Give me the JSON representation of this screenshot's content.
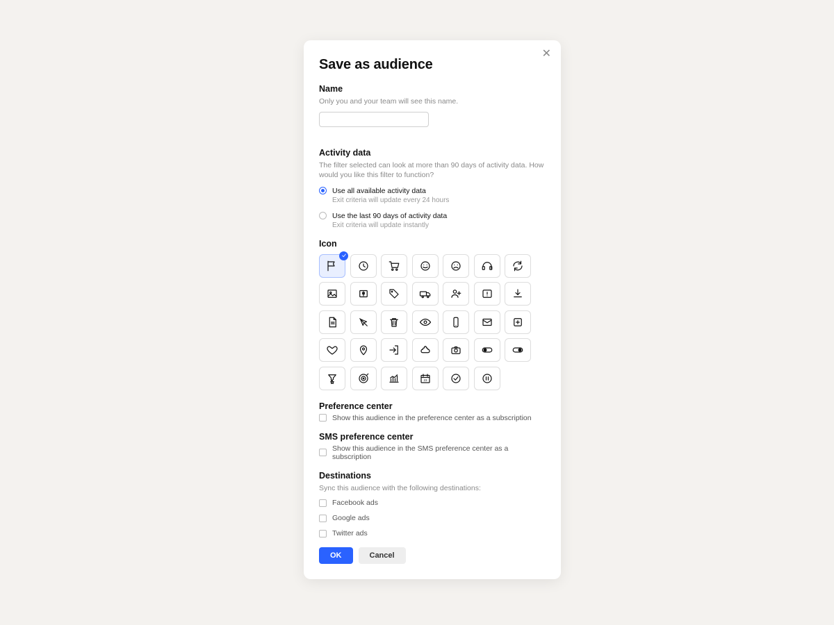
{
  "modal": {
    "title": "Save as audience",
    "name": {
      "label": "Name",
      "helper": "Only you and your team will see this name.",
      "value": ""
    },
    "activity": {
      "label": "Activity data",
      "helper": "The filter selected can look at more than 90 days of activity data. How would you like this filter to function?",
      "options": [
        {
          "label": "Use all available activity data",
          "sub": "Exit criteria will update every 24 hours",
          "selected": true
        },
        {
          "label": "Use the last 90 days of activity data",
          "sub": "Exit criteria will update instantly",
          "selected": false
        }
      ]
    },
    "icon_section": {
      "label": "Icon",
      "selected": "flag-icon",
      "icons": [
        "flag-icon",
        "clock-icon",
        "cart-icon",
        "smile-icon",
        "frown-icon",
        "headset-icon",
        "sync-icon",
        "image-icon",
        "dollar-icon",
        "tag-icon",
        "truck-icon",
        "user-plus-icon",
        "alert-icon",
        "download-icon",
        "file-icon",
        "cursor-off-icon",
        "trash-icon",
        "eye-icon",
        "mobile-icon",
        "mail-icon",
        "add-square-icon",
        "heart-icon",
        "pin-icon",
        "login-icon",
        "poop-icon",
        "camera-icon",
        "toggle-off-icon",
        "toggle-on-icon",
        "funnel-star-icon",
        "target-icon",
        "chart-icon",
        "calendar-icon",
        "check-circle-icon",
        "pause-circle-icon"
      ]
    },
    "pref": {
      "label": "Preference center",
      "checkbox_label": "Show this audience in the preference center as a subscription"
    },
    "sms_pref": {
      "label": "SMS preference center",
      "checkbox_label": "Show this audience in the SMS preference center as a subscription"
    },
    "destinations": {
      "label": "Destinations",
      "helper": "Sync this audience with the following destinations:",
      "items": [
        "Facebook ads",
        "Google ads",
        "Twitter ads"
      ]
    },
    "actions": {
      "ok": "OK",
      "cancel": "Cancel"
    }
  }
}
